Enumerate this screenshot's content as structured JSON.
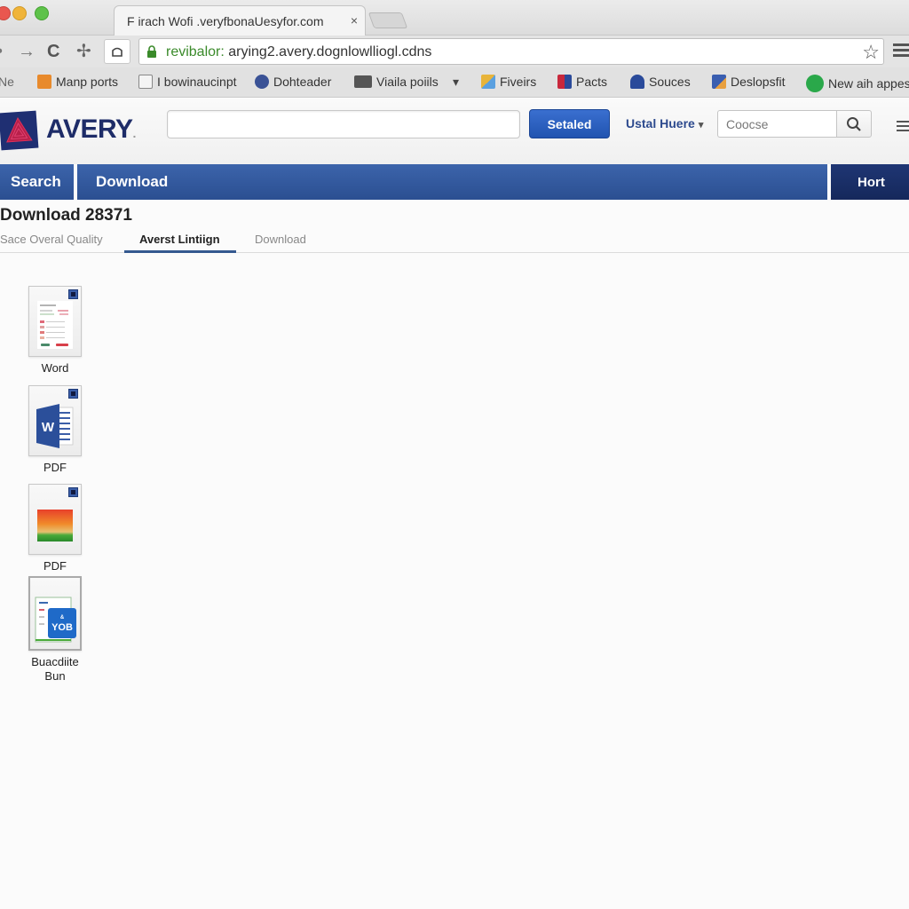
{
  "browser": {
    "tab_title": "F irach Wofi .veryfbonaUesyfor.com",
    "tab_close": "×",
    "url_secure_part": "revibalor: ",
    "url_rest": "arying2.avery.dognlowlliogl.cdns",
    "bookmarks_prefix": "Ne",
    "bookmarks": [
      {
        "label": "Manp ports",
        "icon": "shield-icon",
        "color": "#e88a2c"
      },
      {
        "label": "I bowinaucinpt",
        "icon": "page-icon",
        "color": "#dcdcdc"
      },
      {
        "label": "Dohteader",
        "icon": "globe-icon",
        "color": "#3a5296"
      },
      {
        "label": "Viaila poiils",
        "icon": "video-icon",
        "color": "#555555"
      },
      {
        "label": "Fiveirs",
        "icon": "apps-icon",
        "color": "#e8b43a"
      },
      {
        "label": "Pacts",
        "icon": "book-icon",
        "color": "#c8283c"
      },
      {
        "label": "Souces",
        "icon": "pin-icon",
        "color": "#2a4a9a"
      },
      {
        "label": "Deslopsfit",
        "icon": "doc-icon",
        "color": "#3a5eb0"
      },
      {
        "label": "New aih appes",
        "icon": "circle-app-icon",
        "color": "#2aa84a"
      }
    ],
    "bookmarks_overflow": "▾"
  },
  "header": {
    "logo_text": "AVERY",
    "logo_dot": ".",
    "search_value": "",
    "primary_button": "Setaled",
    "user_menu": "Ustal Huere",
    "user_menu_chevron": "▾",
    "choose_placeholder": "Coocse"
  },
  "nav": {
    "items": [
      "Search",
      "Download"
    ],
    "right_item": "Hort"
  },
  "page": {
    "title": "Download 28371",
    "subtabs": [
      {
        "label": "Sace Overal Quality",
        "active": false
      },
      {
        "label": "Averst Lintiign",
        "active": true
      },
      {
        "label": "Download",
        "active": false
      }
    ]
  },
  "files": [
    {
      "label": "Word",
      "type": "document-preview"
    },
    {
      "label": "PDF",
      "type": "word-doc"
    },
    {
      "label": "PDF",
      "type": "image-gradient"
    },
    {
      "label": "Buacdiite Bun",
      "type": "bundle-box",
      "badge_text": "YOB"
    }
  ],
  "colors": {
    "brand_navy": "#1e2c68",
    "nav_blue": "#2f548f",
    "nav_dark": "#1a2f66",
    "primary_btn": "#2c5fc0",
    "secure_green": "#3a8a2a"
  }
}
